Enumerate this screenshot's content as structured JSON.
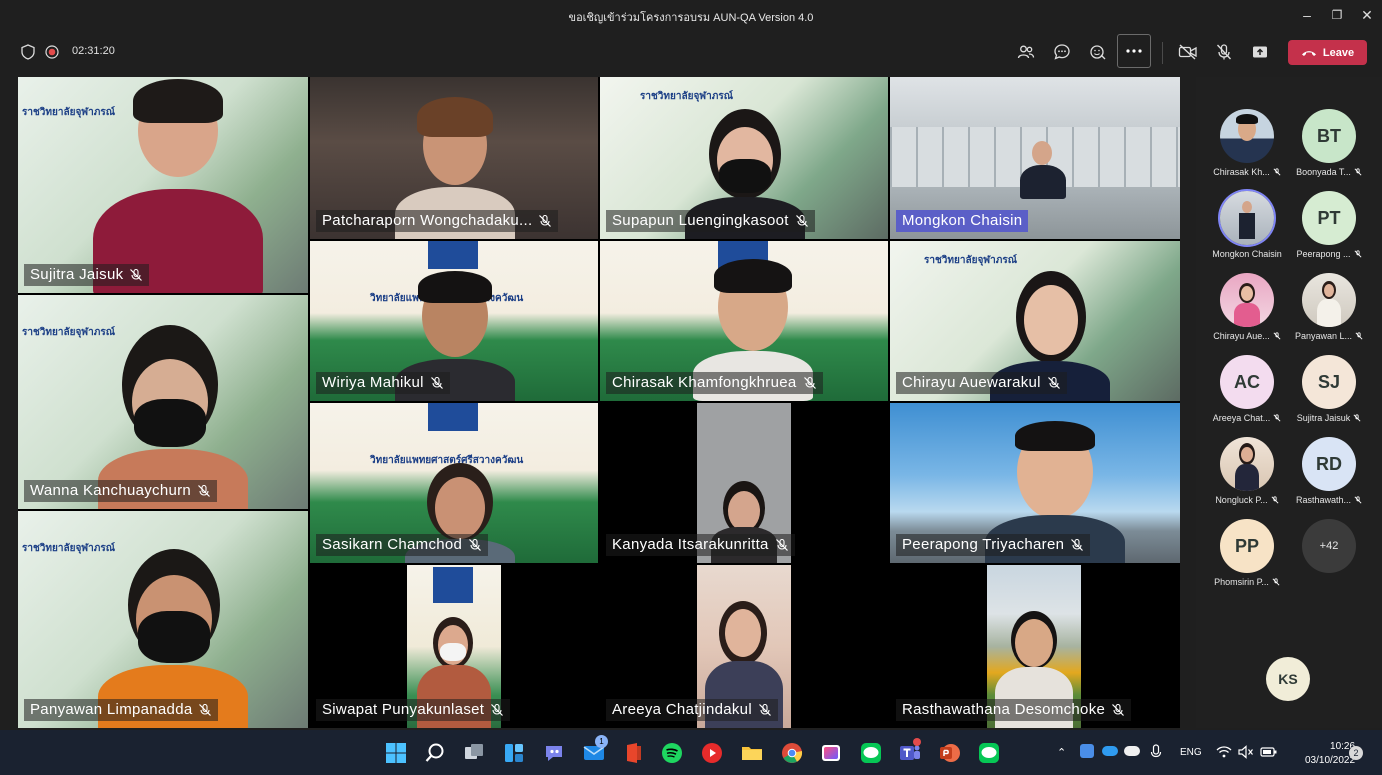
{
  "window": {
    "title": "ขอเชิญเข้าร่วมโครงการอบรม AUN-QA Version 4.0"
  },
  "toolbar": {
    "timer": "02:31:20",
    "leave_label": "Leave"
  },
  "tiles": [
    {
      "name": "Sujitra Jaisuk"
    },
    {
      "name": "Patcharaporn Wongchadaku..."
    },
    {
      "name": "Supapun Luengingkasoot"
    },
    {
      "name": "Mongkon Chaisin"
    },
    {
      "name": "Wiriya Mahikul"
    },
    {
      "name": "Chirasak Khamfongkhruea"
    },
    {
      "name": "Chirayu Auewarakul"
    },
    {
      "name": "Wanna Kanchuaychurn"
    },
    {
      "name": "Sasikarn Chamchod"
    },
    {
      "name": "Kanyada Itsarakunritta"
    },
    {
      "name": "Peerapong  Triyacharen"
    },
    {
      "name": "Panyawan Limpanadda"
    },
    {
      "name": "Siwapat Punyakunlaset"
    },
    {
      "name": "Areeya Chatjindakul"
    },
    {
      "name": "Rasthawathana Desomchoke"
    }
  ],
  "roster": [
    {
      "name": "Chirasak Kh...",
      "initials": ""
    },
    {
      "name": "Boonyada T...",
      "initials": "BT"
    },
    {
      "name": "Mongkon Chaisin",
      "initials": ""
    },
    {
      "name": "Peerapong ...",
      "initials": "PT"
    },
    {
      "name": "Chirayu Aue...",
      "initials": ""
    },
    {
      "name": "Panyawan L...",
      "initials": ""
    },
    {
      "name": "Areeya Chat...",
      "initials": "AC"
    },
    {
      "name": "Sujitra Jaisuk",
      "initials": "SJ"
    },
    {
      "name": "Nongluck P...",
      "initials": ""
    },
    {
      "name": "Rasthawath...",
      "initials": "RD"
    },
    {
      "name": "Phomsirin P...",
      "initials": "PP"
    },
    {
      "name": "",
      "initials": "+42"
    }
  ],
  "self_view": {
    "initials": "KS"
  },
  "taskbar": {
    "lang": "ENG",
    "time": "10:26",
    "date": "03/10/2022",
    "notifications": "2",
    "mail_badge": "1"
  },
  "banner": {
    "thai_line1": "ราชวิทยาลัยจุฬาภรณ์",
    "thai_line2": "วิทยาลัยแพทยศาสตร์ศรีสวางควัฒน"
  }
}
